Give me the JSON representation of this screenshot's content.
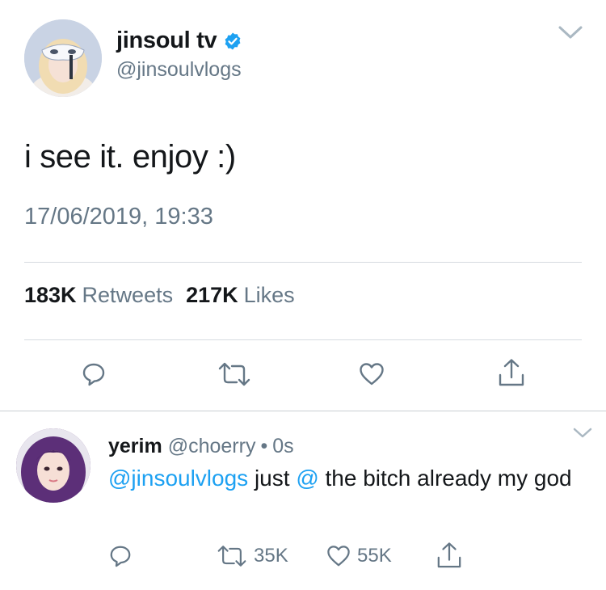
{
  "tweet": {
    "display_name": "jinsoul tv",
    "handle": "@jinsoulvlogs",
    "text": "i see it. enjoy :)",
    "timestamp": "17/06/2019, 19:33",
    "retweets_count": "183K",
    "retweets_label": "Retweets",
    "likes_count": "217K",
    "likes_label": "Likes"
  },
  "reply": {
    "display_name": "yerim",
    "handle": "@choerry",
    "separator": "•",
    "time": "0s",
    "mention": "@jinsoulvlogs",
    "text_part1": " just ",
    "mention2": "@",
    "text_part2": " the bitch already my god",
    "retweet_count": "35K",
    "like_count": "55K"
  },
  "colors": {
    "accent": "#1da1f2",
    "secondary_text": "#657786",
    "primary_text": "#14171a"
  },
  "icons": [
    "verified-badge-icon",
    "chevron-down-icon",
    "reply-icon",
    "retweet-icon",
    "like-icon",
    "share-icon"
  ]
}
